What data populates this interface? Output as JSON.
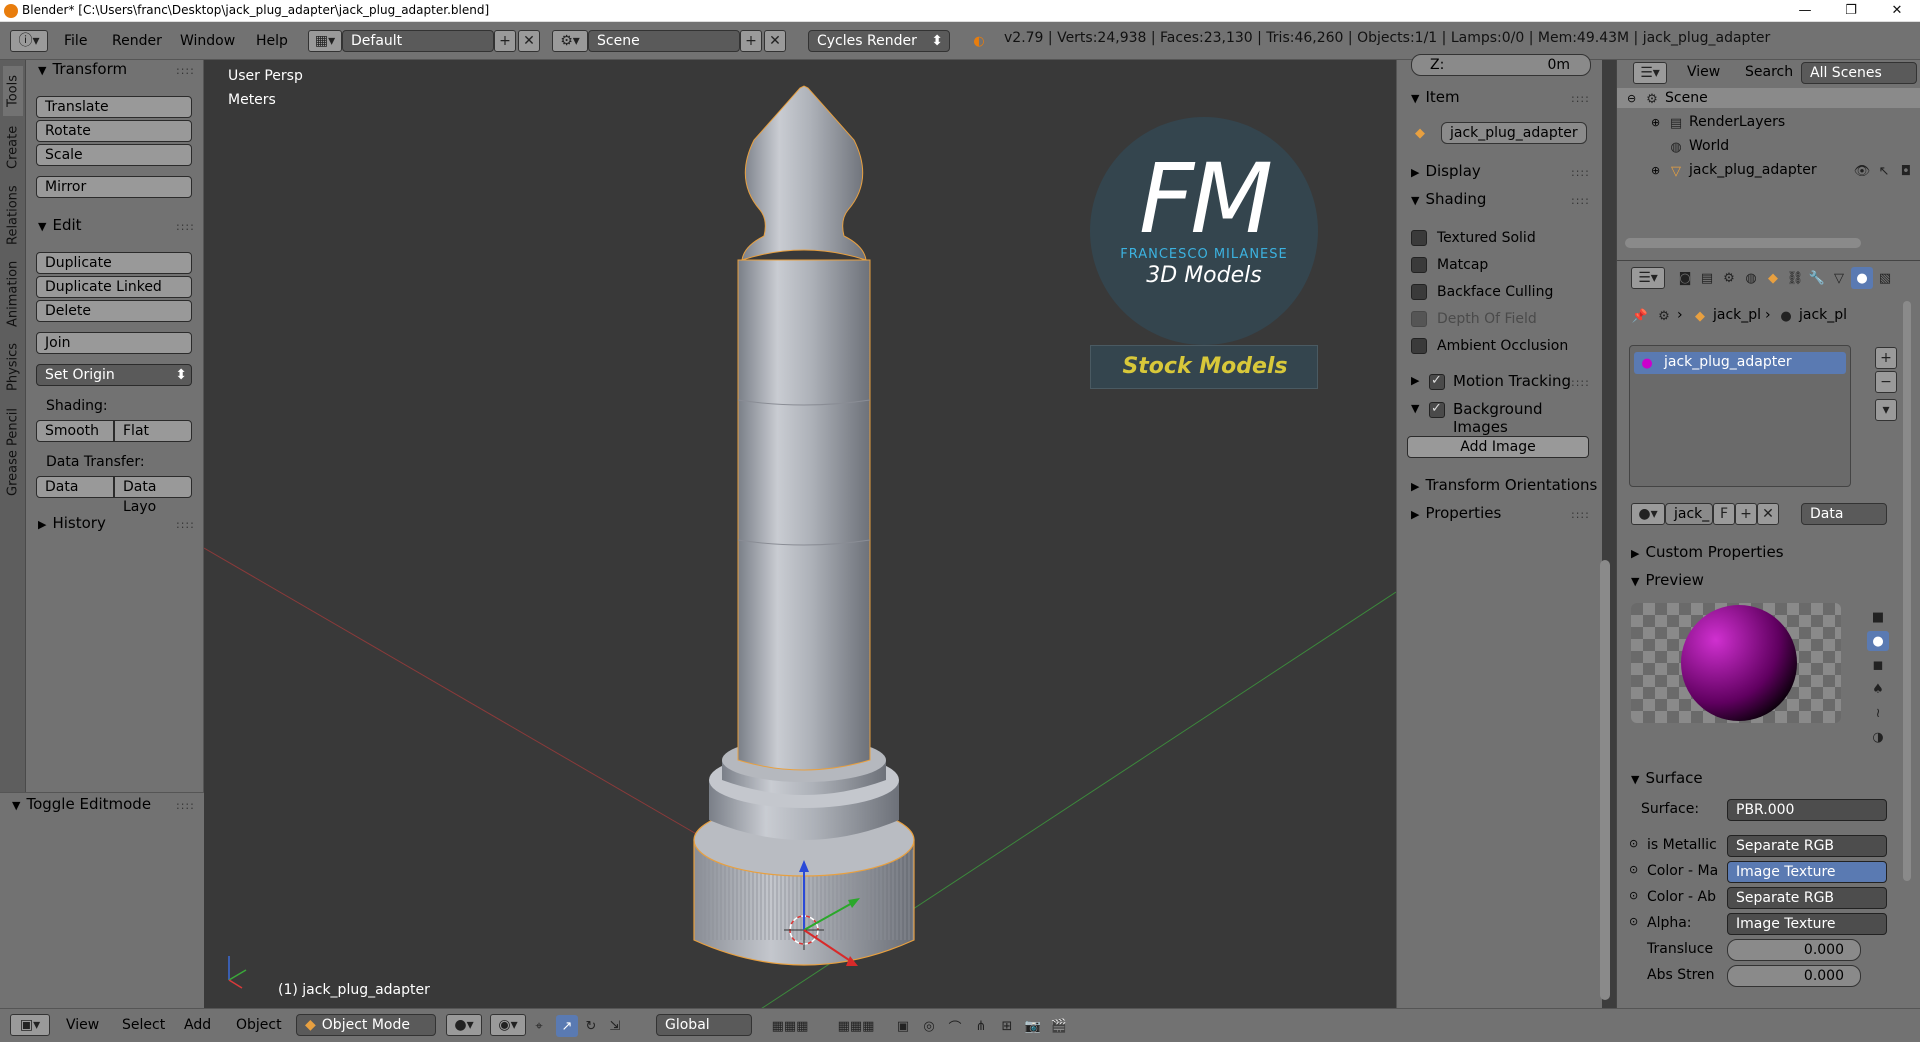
{
  "window": {
    "title": "Blender* [C:\\Users\\franc\\Desktop\\jack_plug_adapter\\jack_plug_adapter.blend]",
    "minimize": "—",
    "maximize": "❐",
    "close": "✕"
  },
  "infobar": {
    "menus": [
      "File",
      "Render",
      "Window",
      "Help"
    ],
    "layout": "Default",
    "scene": "Scene",
    "engine": "Cycles Render",
    "stats": "v2.79 | Verts:24,938 | Faces:23,130 | Tris:46,260 | Objects:1/1 | Lamps:0/0 | Mem:49.43M | jack_plug_adapter"
  },
  "toolshelf": {
    "tabs": [
      "Tools",
      "Create",
      "Relations",
      "Animation",
      "Physics",
      "Grease Pencil"
    ],
    "transform_header": "Transform",
    "translate": "Translate",
    "rotate": "Rotate",
    "scale": "Scale",
    "mirror": "Mirror",
    "edit_header": "Edit",
    "duplicate": "Duplicate",
    "duplicate_linked": "Duplicate Linked",
    "delete": "Delete",
    "join": "Join",
    "set_origin": "Set Origin",
    "shading_label": "Shading:",
    "smooth": "Smooth",
    "flat": "Flat",
    "data_transfer_label": "Data Transfer:",
    "data": "Data",
    "data_layout": "Data Layo",
    "history_header": "History",
    "toggle_editmode": "Toggle Editmode"
  },
  "viewport": {
    "view_name": "User Persp",
    "units": "Meters",
    "object_label": "(1) jack_plug_adapter",
    "watermark": {
      "initials": "FM",
      "name": "FRANCESCO MILANESE",
      "subtitle": "3D Models",
      "stock": "Stock Models"
    }
  },
  "npanel": {
    "z_label": "Z:",
    "z_value": "0m",
    "item_header": "Item",
    "item_name": "jack_plug_adapter",
    "display_header": "Display",
    "shading_header": "Shading",
    "textured_solid": "Textured Solid",
    "matcap": "Matcap",
    "backface_culling": "Backface Culling",
    "depth_of_field": "Depth Of Field",
    "ambient_occlusion": "Ambient Occlusion",
    "motion_tracking": "Motion Tracking",
    "background_images": "Background Images",
    "add_image": "Add Image",
    "transform_orientations": "Transform Orientations",
    "properties": "Properties"
  },
  "outliner": {
    "view": "View",
    "search": "Search",
    "filter": "All Scenes",
    "items": [
      "Scene",
      "RenderLayers",
      "World",
      "jack_plug_adapter"
    ]
  },
  "properties": {
    "breadcrumb": [
      "jack_pl",
      "jack_pl"
    ],
    "material_slot": "jack_plug_adapter",
    "material_name": "jack_",
    "fake_user": "F",
    "link": "Data",
    "custom_properties": "Custom Properties",
    "preview": "Preview",
    "surface_header": "Surface",
    "surface_label": "Surface:",
    "surface_value": "PBR.000",
    "is_metallic_label": "is Metallic",
    "is_metallic_value": "Separate RGB",
    "color_ma_label": "Color - Ma",
    "color_ma_value": "Image Texture",
    "color_ab_label": "Color - Ab",
    "color_ab_value": "Separate RGB",
    "alpha_label": "Alpha:",
    "alpha_value": "Image Texture",
    "transluce_label": "Transluce",
    "transluce_value": "0.000",
    "abs_stren_label": "Abs Stren",
    "abs_stren_value": "0.000"
  },
  "bottombar": {
    "menus": [
      "View",
      "Select",
      "Add",
      "Object"
    ],
    "mode": "Object Mode",
    "orientation": "Global"
  }
}
